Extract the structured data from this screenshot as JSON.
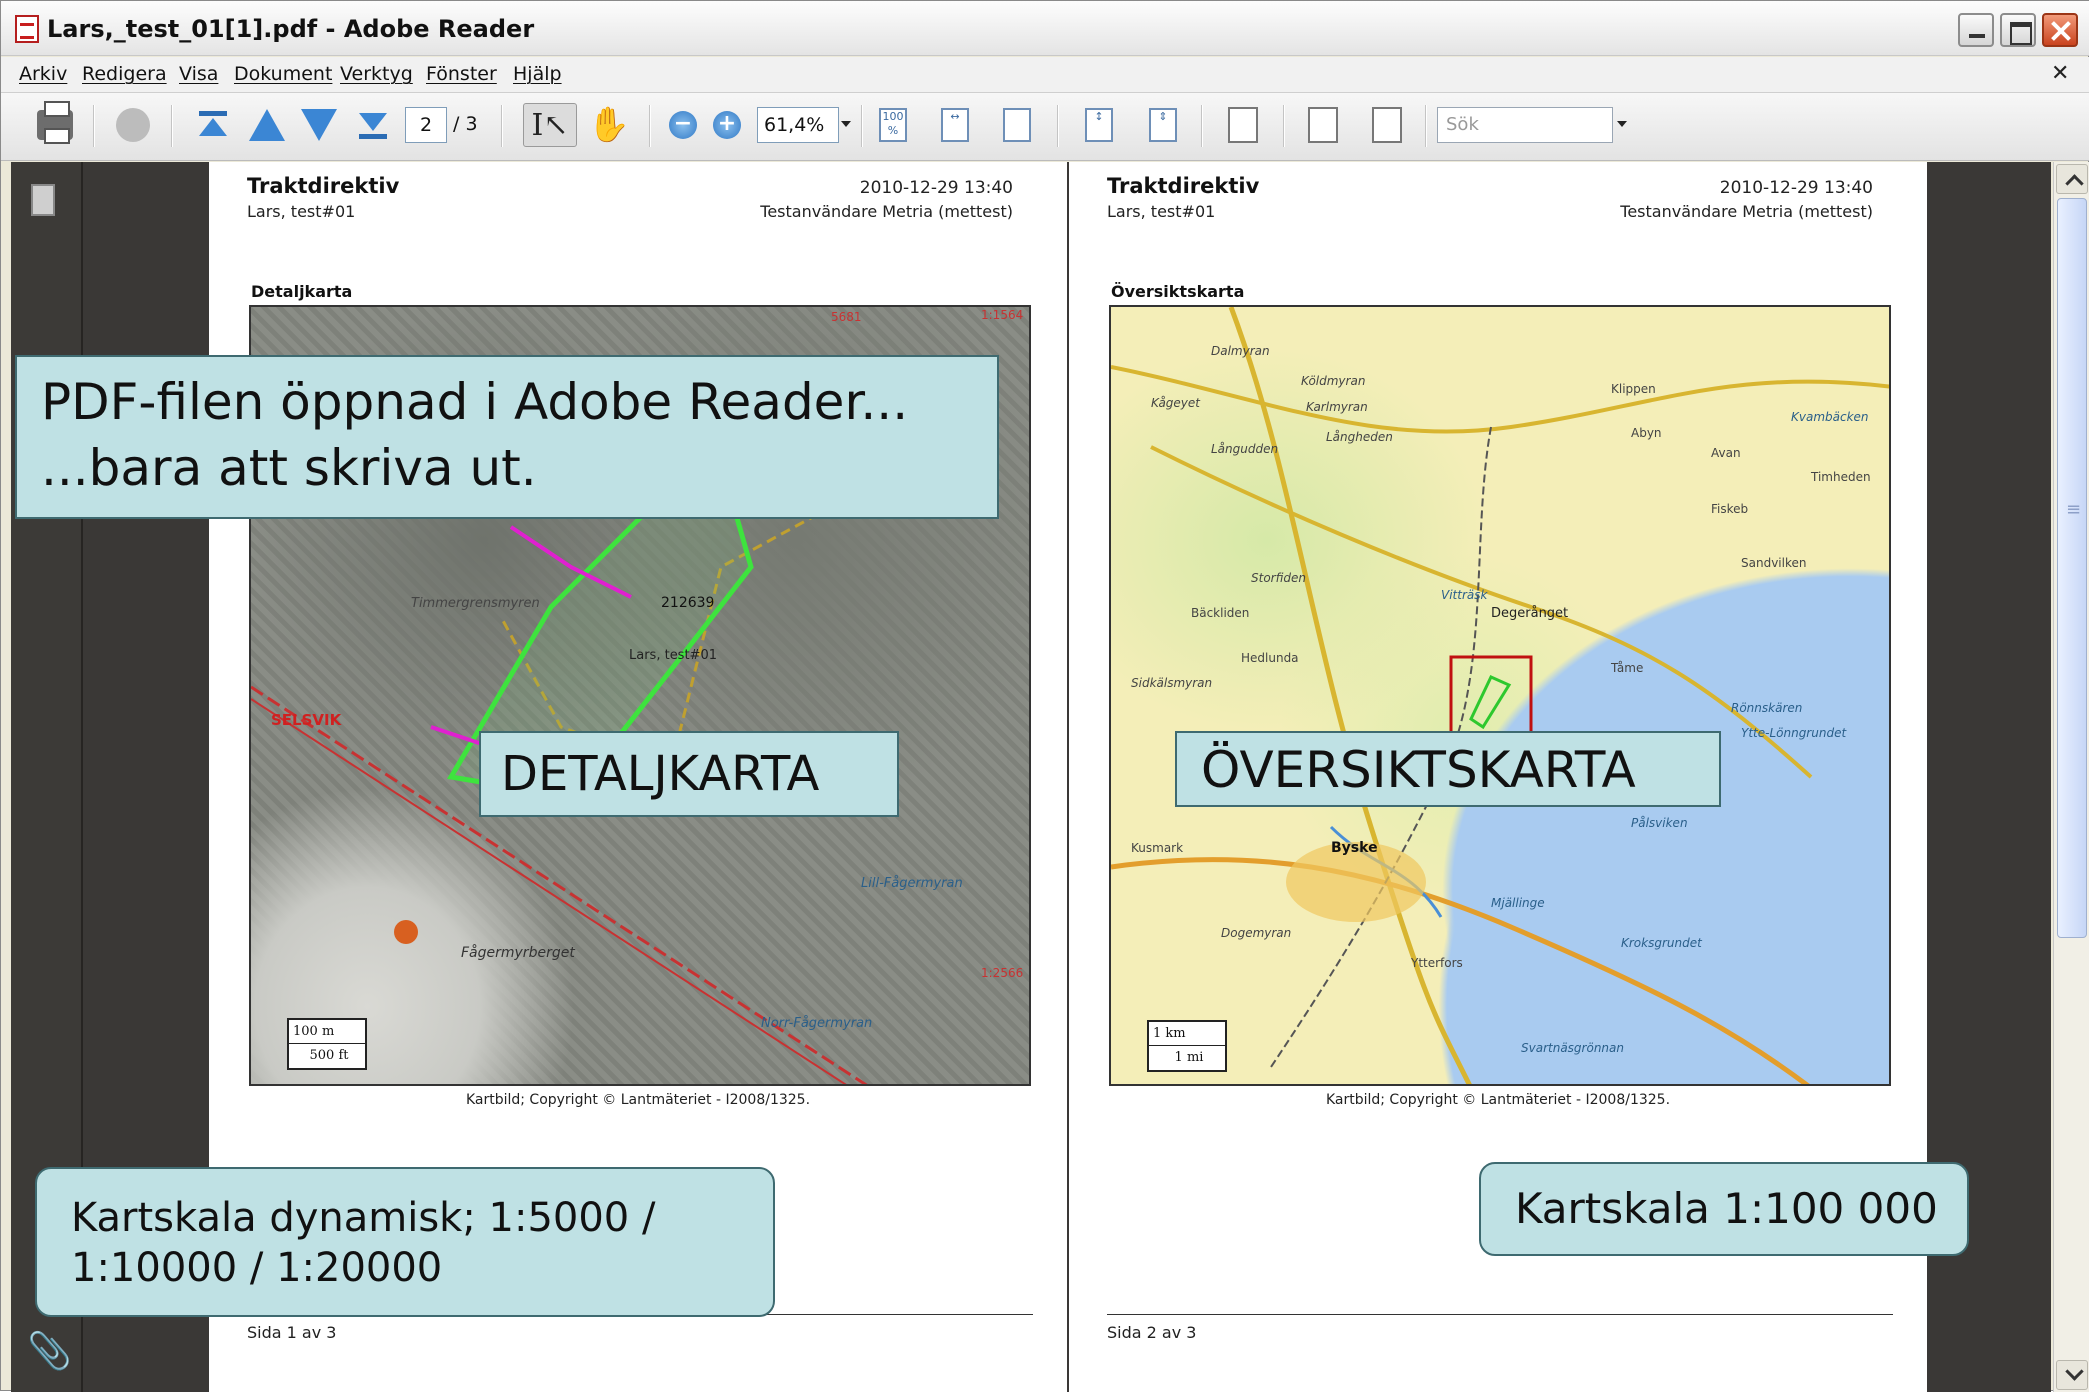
{
  "window": {
    "title": "Lars,_test_01[1].pdf - Adobe Reader"
  },
  "menu": [
    "Arkiv",
    "Redigera",
    "Visa",
    "Dokument",
    "Verktyg",
    "Fönster",
    "Hjälp"
  ],
  "toolbar": {
    "page_current": "2",
    "page_total": "/ 3",
    "zoom": "61,4%",
    "search_placeholder": "Sök",
    "icons": [
      "print-icon",
      "share-icon",
      "first-page-icon",
      "prev-page-icon",
      "next-page-icon",
      "last-page-icon",
      "select-text-icon",
      "hand-tool-icon",
      "zoom-out-icon",
      "zoom-in-icon",
      "actual-size-icon",
      "fit-width-icon",
      "fit-page-icon",
      "single-page-icon",
      "continuous-icon",
      "reading-mode-icon",
      "facing-icon",
      "rotate-icon"
    ]
  },
  "pages": [
    {
      "title": "Traktdirektiv",
      "user": "Lars, test#01",
      "datetime": "2010-12-29 13:40",
      "customer": "Testanvändare Metria (mettest)",
      "section": "Detaljkarta",
      "map_labels": [
        "212639",
        "Lars, test#01",
        "SELSVIK",
        "Fågermyrberget",
        "Timmergrensmyren",
        "Norr-Fågermyran",
        "Lill-Fågermyran",
        "1:1564",
        "1:2566",
        "5681"
      ],
      "scale": [
        "100 m",
        "500 ft"
      ],
      "copyright": "Kartbild; Copyright © Lantmäteriet - I2008/1325.",
      "footer": "Sida 1 av 3"
    },
    {
      "title": "Traktdirektiv",
      "user": "Lars, test#01",
      "datetime": "2010-12-29 13:40",
      "customer": "Testanvändare Metria (mettest)",
      "section": "Översiktskarta",
      "map_labels": [
        "Dalmyran",
        "Köldmyran",
        "Kågeyet",
        "Karlmyran",
        "Långheden",
        "Långudden",
        "Storfiden",
        "Vitträsk",
        "Degerånget",
        "Bäckliden",
        "Hedlunda",
        "Sidkälsmyran",
        "Byske",
        "Dogemyran",
        "Ytterfors",
        "Pålsviken",
        "Kroksgrundet",
        "Mjällinge",
        "Svartnäsgrönnan",
        "Rönnskären",
        "Ytte-Lönngrundet",
        "Abyn",
        "Klippen",
        "Kvambäcken",
        "Avan",
        "Timheden",
        "Fiskeb",
        "Sandvilken",
        "Tåme",
        "Kusmark"
      ],
      "scale": [
        "1 km",
        "1 mi"
      ],
      "copyright": "Kartbild; Copyright © Lantmäteriet - I2008/1325.",
      "footer": "Sida 2 av 3"
    }
  ],
  "callouts": {
    "main_line1": "PDF-filen öppnad i Adobe Reader...",
    "main_line2": "...bara att skriva ut.",
    "detail": "DETALJKARTA",
    "overview": "ÖVERSIKTSKARTA",
    "scale_dynamic_line1": "Kartskala dynamisk; 1:5000 /",
    "scale_dynamic_line2": "1:10000 / 1:20000",
    "scale_fixed": "Kartskala 1:100 000"
  },
  "colors": {
    "callout_bg": "#bfe1e4",
    "callout_border": "#3e6a70",
    "doc_bg": "#3a3836",
    "property_green": "#3ee33e",
    "road_red": "#c83232",
    "route_magenta": "#e020d0"
  }
}
